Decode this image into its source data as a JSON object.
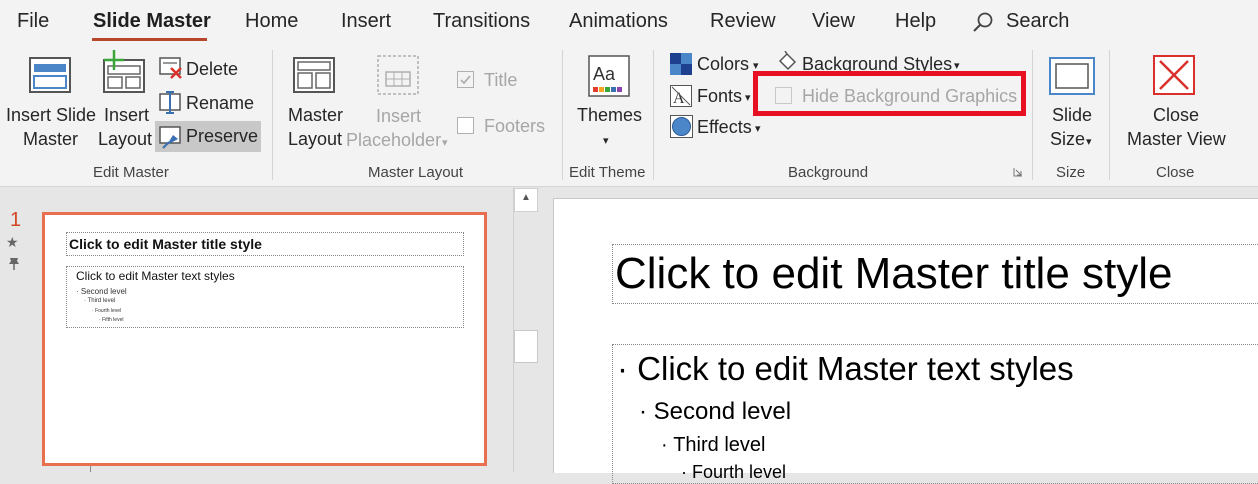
{
  "tabs": {
    "file": "File",
    "slide_master": "Slide Master",
    "home": "Home",
    "insert": "Insert",
    "transitions": "Transitions",
    "animations": "Animations",
    "review": "Review",
    "view": "View",
    "help": "Help",
    "search": "Search"
  },
  "ribbon": {
    "edit_master": {
      "insert_slide_master_l1": "Insert Slide",
      "insert_slide_master_l2": "Master",
      "insert_layout_l1": "Insert",
      "insert_layout_l2": "Layout",
      "delete": "Delete",
      "rename": "Rename",
      "preserve": "Preserve",
      "group_label": "Edit Master"
    },
    "master_layout": {
      "master_layout_l1": "Master",
      "master_layout_l2": "Layout",
      "insert_placeholder_l1": "Insert",
      "insert_placeholder_l2": "Placeholder",
      "title": "Title",
      "footers": "Footers",
      "group_label": "Master Layout"
    },
    "edit_theme": {
      "themes": "Themes",
      "group_label": "Edit Theme"
    },
    "background": {
      "colors": "Colors",
      "fonts": "Fonts",
      "effects": "Effects",
      "background_styles": "Background Styles",
      "hide_background_graphics": "Hide Background Graphics",
      "group_label": "Background"
    },
    "size": {
      "slide_size_l1": "Slide",
      "slide_size_l2": "Size",
      "group_label": "Size"
    },
    "close": {
      "close_l1": "Close",
      "close_l2": "Master View",
      "group_label": "Close"
    }
  },
  "thumbnail": {
    "number": "1",
    "title": "Click to edit Master title style",
    "body": "Click to edit Master text styles",
    "level2": "Second level",
    "level3": "Third level",
    "level4": "Fourth level",
    "level5": "Fifth level"
  },
  "slide": {
    "title": "Click to edit Master title style",
    "body": "Click to edit Master text styles",
    "level2": "Second level",
    "level3": "Third level",
    "level4": "Fourth level"
  },
  "colors": {
    "accent": "#b7472a",
    "thumb_border": "#e8704f",
    "highlight": "#e81123"
  }
}
